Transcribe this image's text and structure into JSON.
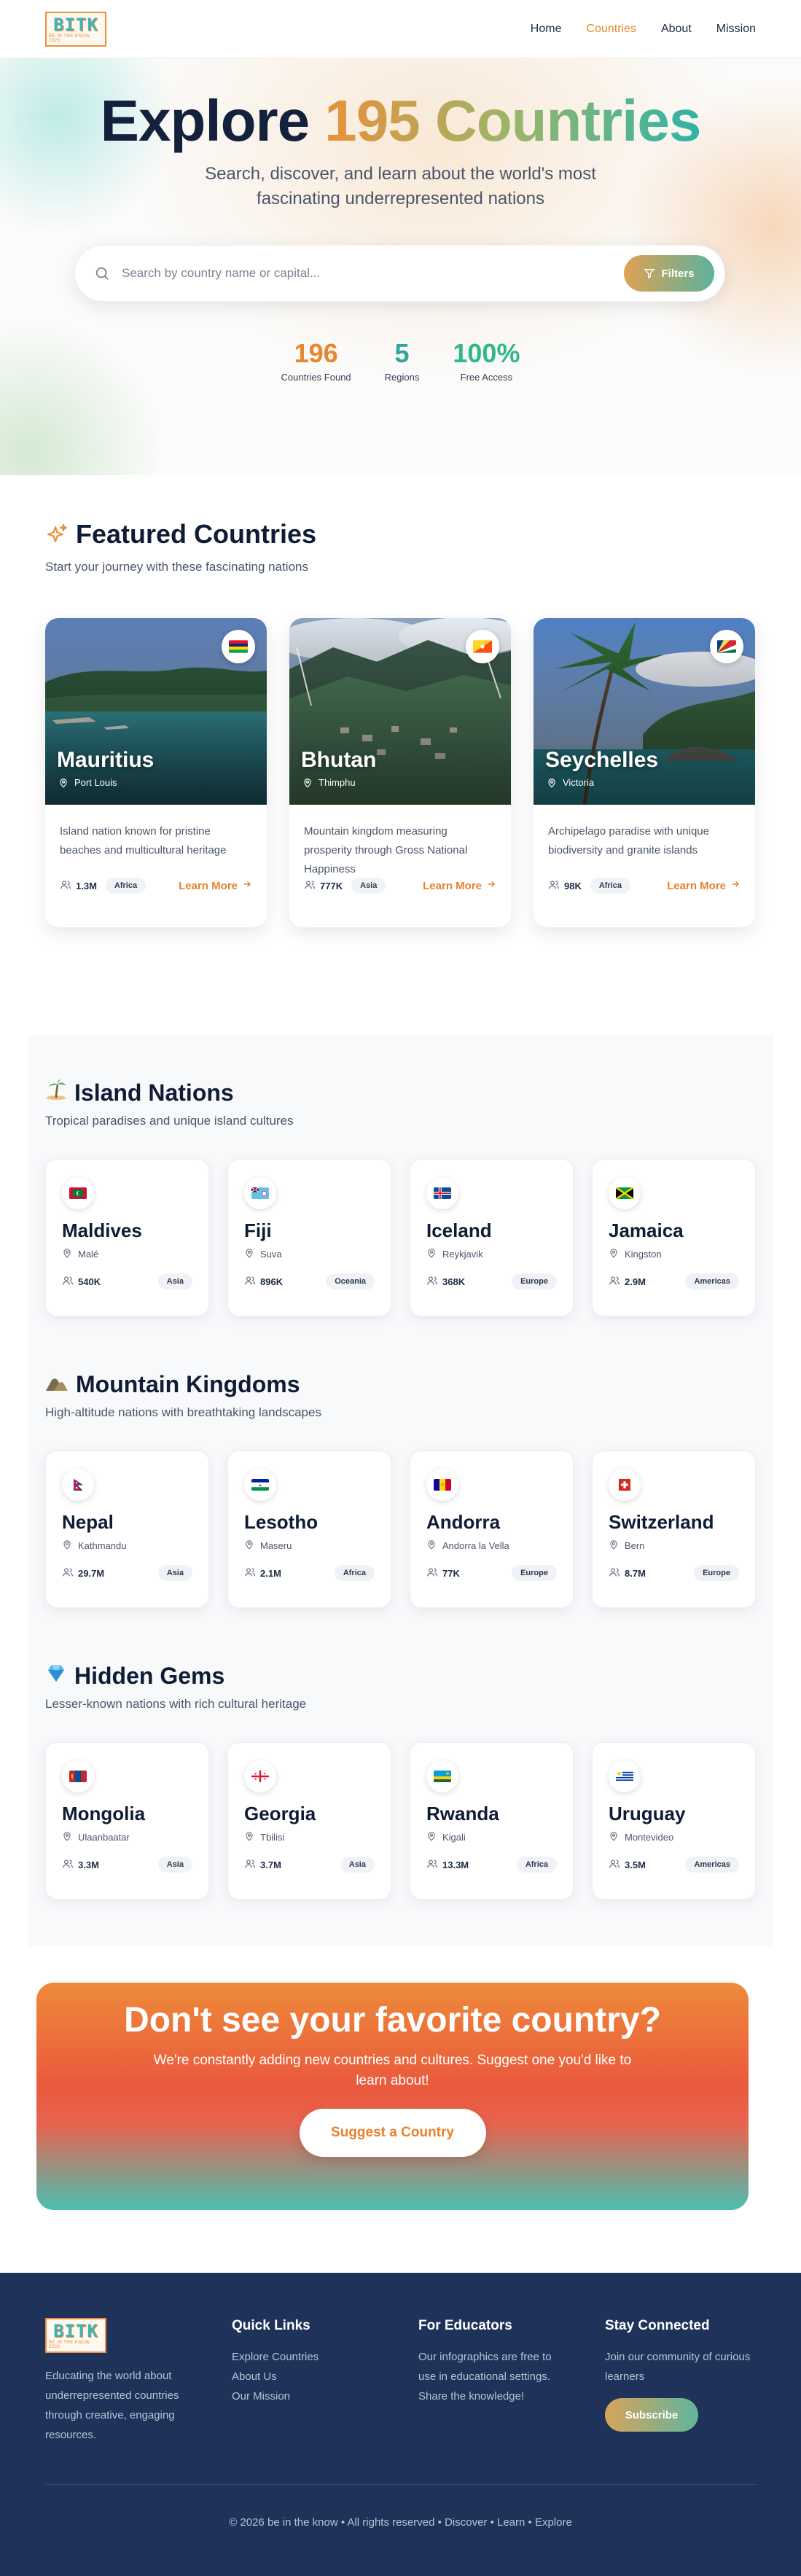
{
  "brand": {
    "logo_text": "BITK",
    "logo_sub": "BE IN THE KNOW 2026"
  },
  "nav": {
    "items": [
      {
        "label": "Home",
        "active": false
      },
      {
        "label": "Countries",
        "active": true
      },
      {
        "label": "About",
        "active": false
      },
      {
        "label": "Mission",
        "active": false
      }
    ]
  },
  "hero": {
    "title_part1": "Explore",
    "title_part2": "195 Countries",
    "subtitle": "Search, discover, and learn about the world's most fascinating underrepresented nations",
    "search_placeholder": "Search by country name or capital...",
    "filters_label": "Filters",
    "stats": [
      {
        "value": "196",
        "label": "Countries Found",
        "color": "#e8852f"
      },
      {
        "value": "5",
        "label": "Regions",
        "color": "#2ea79a"
      },
      {
        "value": "100%",
        "label": "Free Access",
        "color": "#2fb889"
      }
    ]
  },
  "featured": {
    "title": "Featured Countries",
    "description": "Start your journey with these fascinating nations",
    "learn_more_label": "Learn More",
    "cards": [
      {
        "name": "Mauritius",
        "capital": "Port Louis",
        "description": "Island nation known for pristine beaches and multicultural heritage",
        "population": "1.3M",
        "region": "Africa",
        "flag": "mauritius"
      },
      {
        "name": "Bhutan",
        "capital": "Thimphu",
        "description": "Mountain kingdom measuring prosperity through Gross National Happiness",
        "population": "777K",
        "region": "Asia",
        "flag": "bhutan"
      },
      {
        "name": "Seychelles",
        "capital": "Victoria",
        "description": "Archipelago paradise with unique biodiversity and granite islands",
        "population": "98K",
        "region": "Africa",
        "flag": "seychelles"
      }
    ]
  },
  "categories": [
    {
      "icon": "island-icon",
      "title": "Island Nations",
      "description": "Tropical paradises and unique island cultures",
      "countries": [
        {
          "name": "Maldives",
          "capital": "Malé",
          "population": "540K",
          "region": "Asia",
          "flag": "maldives"
        },
        {
          "name": "Fiji",
          "capital": "Suva",
          "population": "896K",
          "region": "Oceania",
          "flag": "fiji"
        },
        {
          "name": "Iceland",
          "capital": "Reykjavik",
          "population": "368K",
          "region": "Europe",
          "flag": "iceland"
        },
        {
          "name": "Jamaica",
          "capital": "Kingston",
          "population": "2.9M",
          "region": "Americas",
          "flag": "jamaica"
        }
      ]
    },
    {
      "icon": "mountain-icon",
      "title": "Mountain Kingdoms",
      "description": "High-altitude nations with breathtaking landscapes",
      "countries": [
        {
          "name": "Nepal",
          "capital": "Kathmandu",
          "population": "29.7M",
          "region": "Asia",
          "flag": "nepal"
        },
        {
          "name": "Lesotho",
          "capital": "Maseru",
          "population": "2.1M",
          "region": "Africa",
          "flag": "lesotho"
        },
        {
          "name": "Andorra",
          "capital": "Andorra la Vella",
          "population": "77K",
          "region": "Europe",
          "flag": "andorra"
        },
        {
          "name": "Switzerland",
          "capital": "Bern",
          "population": "8.7M",
          "region": "Europe",
          "flag": "switzerland"
        }
      ]
    },
    {
      "icon": "gem-icon",
      "title": "Hidden Gems",
      "description": "Lesser-known nations with rich cultural heritage",
      "countries": [
        {
          "name": "Mongolia",
          "capital": "Ulaanbaatar",
          "population": "3.3M",
          "region": "Asia",
          "flag": "mongolia"
        },
        {
          "name": "Georgia",
          "capital": "Tbilisi",
          "population": "3.7M",
          "region": "Asia",
          "flag": "georgia"
        },
        {
          "name": "Rwanda",
          "capital": "Kigali",
          "population": "13.3M",
          "region": "Africa",
          "flag": "rwanda"
        },
        {
          "name": "Uruguay",
          "capital": "Montevideo",
          "population": "3.5M",
          "region": "Americas",
          "flag": "uruguay"
        }
      ]
    }
  ],
  "cta": {
    "title": "Don't see your favorite country?",
    "text": "We're constantly adding new countries and cultures. Suggest one you'd like to learn about!",
    "button": "Suggest a Country"
  },
  "footer": {
    "about": "Educating the world about underrepresented countries through creative, engaging resources.",
    "quick_links_title": "Quick Links",
    "quick_links": [
      "Explore Countries",
      "About Us",
      "Our Mission"
    ],
    "educators_title": "For Educators",
    "educators_text": "Our infographics are free to use in educational settings. Share the knowledge!",
    "connect_title": "Stay Connected",
    "connect_text": "Join our community of curious learners",
    "subscribe_label": "Subscribe",
    "copyright": "© 2026 be in the know • All rights reserved • Discover • Learn • Explore"
  }
}
